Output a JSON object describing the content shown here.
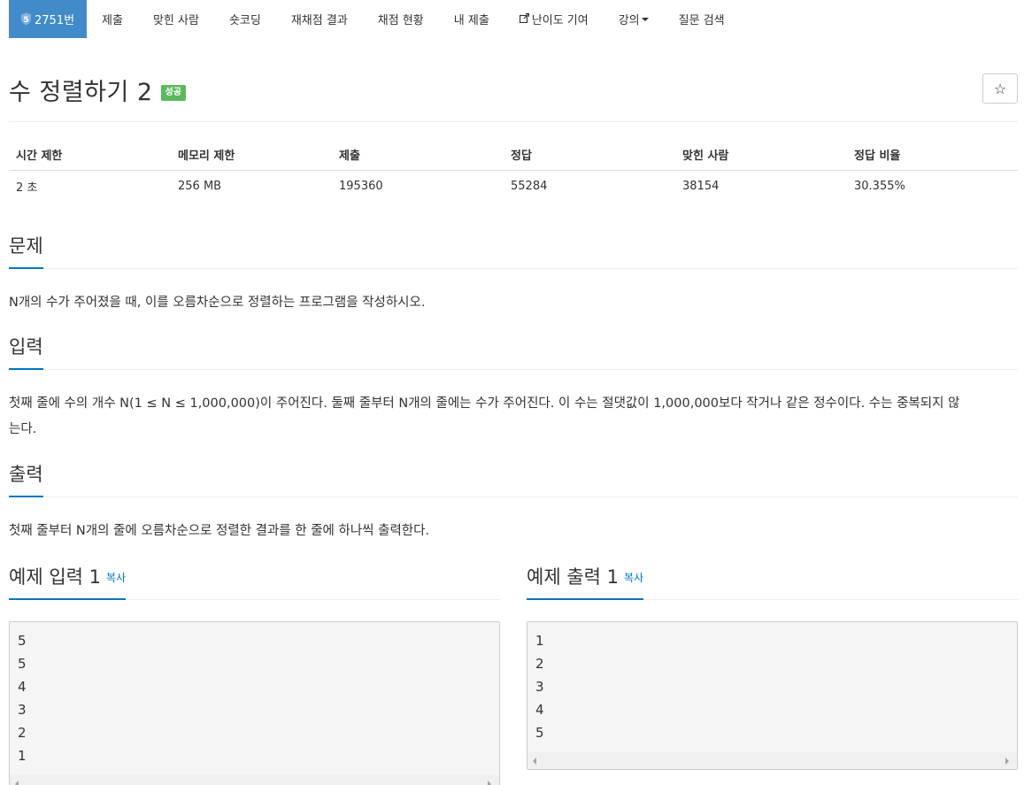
{
  "nav": {
    "problem_tab": "2751번",
    "tier_badge": "5",
    "items": [
      {
        "label": "제출"
      },
      {
        "label": "맞힌 사람"
      },
      {
        "label": "숏코딩"
      },
      {
        "label": "재채점 결과"
      },
      {
        "label": "채점 현황"
      },
      {
        "label": "내 제출"
      },
      {
        "label": "난이도 기여"
      },
      {
        "label": "강의"
      },
      {
        "label": "질문 검색"
      }
    ]
  },
  "problem": {
    "title": "수 정렬하기 2",
    "status_badge": "성공",
    "star_icon": "☆"
  },
  "info_table": {
    "headers": [
      "시간 제한",
      "메모리 제한",
      "제출",
      "정답",
      "맞힌 사람",
      "정답 비율"
    ],
    "values": [
      "2 초",
      "256 MB",
      "195360",
      "55284",
      "38154",
      "30.355%"
    ]
  },
  "sections": {
    "description": {
      "heading": "문제",
      "text": "N개의 수가 주어졌을 때, 이를 오름차순으로 정렬하는 프로그램을 작성하시오."
    },
    "input": {
      "heading": "입력",
      "line1": "첫째 줄에 수의 개수 N(1 ≤ N ≤ 1,000,000)이 주어진다. 둘째 줄부터 N개의 줄에는 수가 주어진다. 이 수는 절댓값이 1,000,000보다 작거나 같은 정수이다. 수는 중복되지 않",
      "line2": "는다."
    },
    "output": {
      "heading": "출력",
      "text": "첫째 줄부터 N개의 줄에 오름차순으로 정렬한 결과를 한 줄에 하나씩 출력한다."
    }
  },
  "examples": {
    "input": {
      "heading": "예제 입력 1",
      "copy_label": "복사",
      "lines": [
        "5",
        "5",
        "4",
        "3",
        "2",
        "1"
      ]
    },
    "output": {
      "heading": "예제 출력 1",
      "copy_label": "복사",
      "lines": [
        "1",
        "2",
        "3",
        "4",
        "5"
      ]
    }
  },
  "colors": {
    "nav_active": "#428bca",
    "badge_success": "#5cb85c",
    "accent": "#0076c0"
  }
}
